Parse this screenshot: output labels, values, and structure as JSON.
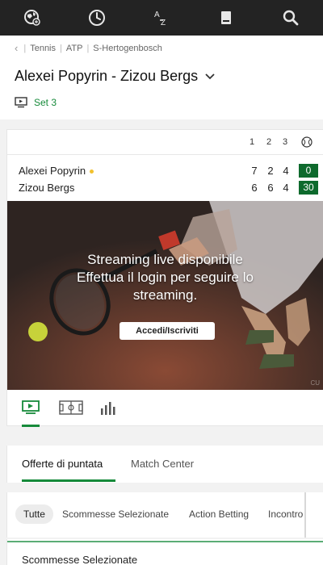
{
  "nav": {
    "icons": [
      "soccer-globe-icon",
      "clock-icon",
      "a-z-sort-icon",
      "betslip-icon",
      "search-icon"
    ],
    "az_top": "A",
    "az_bottom": "Z"
  },
  "breadcrumb": {
    "items": [
      "Tennis",
      "ATP",
      "S-Hertogenbosch"
    ]
  },
  "match": {
    "title": "Alexei Popyrin - Zizou Bergs",
    "set_label": "Set 3"
  },
  "score": {
    "headers": [
      "1",
      "2",
      "3"
    ],
    "players": [
      {
        "name": "Alexei Popyrin",
        "serving": true,
        "sets": [
          "7",
          "2",
          "4"
        ],
        "points": "0"
      },
      {
        "name": "Zizou Bergs",
        "serving": false,
        "sets": [
          "6",
          "6",
          "4"
        ],
        "points": "30"
      }
    ]
  },
  "stream": {
    "line1": "Streaming live disponibile",
    "line2": "Effettua il login per seguire lo",
    "line3": "streaming.",
    "button": "Accedi/Iscriviti",
    "watermark": "CU"
  },
  "media_tabs": [
    "tv-icon",
    "field-icon",
    "stats-icon"
  ],
  "offer_tabs": {
    "active": "Offerte di puntata",
    "other": "Match Center"
  },
  "filters": [
    "Tutte",
    "Scommesse Selezionate",
    "Action Betting",
    "Incontro"
  ],
  "bottom": {
    "label": "Scommesse Selezionate"
  },
  "colors": {
    "accent": "#168a3a",
    "score_box": "#0e6a2d",
    "topbar": "#232323",
    "serve": "#f2c12e"
  }
}
